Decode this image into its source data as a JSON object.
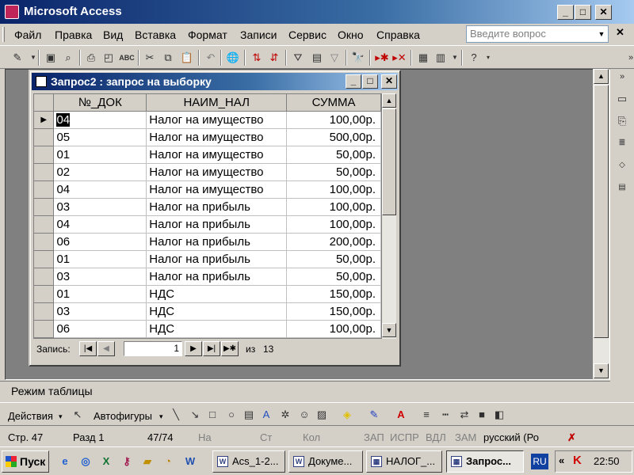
{
  "app": {
    "title": "Microsoft Access"
  },
  "menu": {
    "items": [
      "Файл",
      "Правка",
      "Вид",
      "Вставка",
      "Формат",
      "Записи",
      "Сервис",
      "Окно",
      "Справка"
    ],
    "ask_placeholder": "Введите вопрос"
  },
  "toolbar": {
    "icons": [
      "design-view-icon",
      "save-icon",
      "print-icon",
      "print-preview-icon",
      "spelling-icon",
      "cut-icon",
      "copy-icon",
      "paste-icon",
      "undo-icon",
      "hyperlink-icon",
      "sort-ascending-icon",
      "sort-descending-icon",
      "filter-by-selection-icon",
      "filter-by-form-icon",
      "apply-filter-icon",
      "find-icon",
      "new-record-icon",
      "delete-record-icon",
      "properties-icon",
      "database-window-icon",
      "help-icon"
    ]
  },
  "query_window": {
    "title": "Запрос2 : запрос на выборку",
    "columns": [
      "№_ДОК",
      "НАИМ_НАЛ",
      "СУММА"
    ],
    "rows": [
      {
        "doc": "04",
        "name": "Налог на имущество",
        "sum": "100,00р."
      },
      {
        "doc": "05",
        "name": "Налог на имущество",
        "sum": "500,00р."
      },
      {
        "doc": "01",
        "name": "Налог на имущество",
        "sum": "50,00р."
      },
      {
        "doc": "02",
        "name": "Налог на имущество",
        "sum": "50,00р."
      },
      {
        "doc": "04",
        "name": "Налог на имущество",
        "sum": "100,00р."
      },
      {
        "doc": "03",
        "name": "Налог на прибыль",
        "sum": "100,00р."
      },
      {
        "doc": "04",
        "name": "Налог на прибыль",
        "sum": "100,00р."
      },
      {
        "doc": "06",
        "name": "Налог на прибыль",
        "sum": "200,00р."
      },
      {
        "doc": "01",
        "name": "Налог на прибыль",
        "sum": "50,00р."
      },
      {
        "doc": "03",
        "name": "Налог на прибыль",
        "sum": "50,00р."
      },
      {
        "doc": "01",
        "name": "НДС",
        "sum": "150,00р."
      },
      {
        "doc": "03",
        "name": "НДС",
        "sum": "150,00р."
      },
      {
        "doc": "06",
        "name": "НДС",
        "sum": "100,00р."
      }
    ],
    "new_row_marker": "*",
    "current_row_marker": "▶",
    "nav": {
      "record_label": "Запись:",
      "current_record": "1",
      "of_label": "из",
      "total": "13"
    }
  },
  "mode_line": "Режим таблицы",
  "draw_toolbar": {
    "actions_label": "Действия",
    "autoshapes_label": "Автофигуры"
  },
  "status": {
    "page": "Стр. 47",
    "section": "Разд 1",
    "pages": "47/74",
    "at": "На",
    "line": "Ст",
    "col": "Кол",
    "rec": "ЗАП",
    "trk": "ИСПР",
    "ext": "ВДЛ",
    "ovr": "ЗАМ",
    "language": "русский (Ро"
  },
  "taskbar": {
    "start_label": "Пуск",
    "tasks": [
      "Acs_1-2...",
      "Докуме...",
      "НАЛОГ_...",
      "Запрос..."
    ],
    "active_task_index": 3,
    "language": "RU",
    "clock": "22:50"
  }
}
